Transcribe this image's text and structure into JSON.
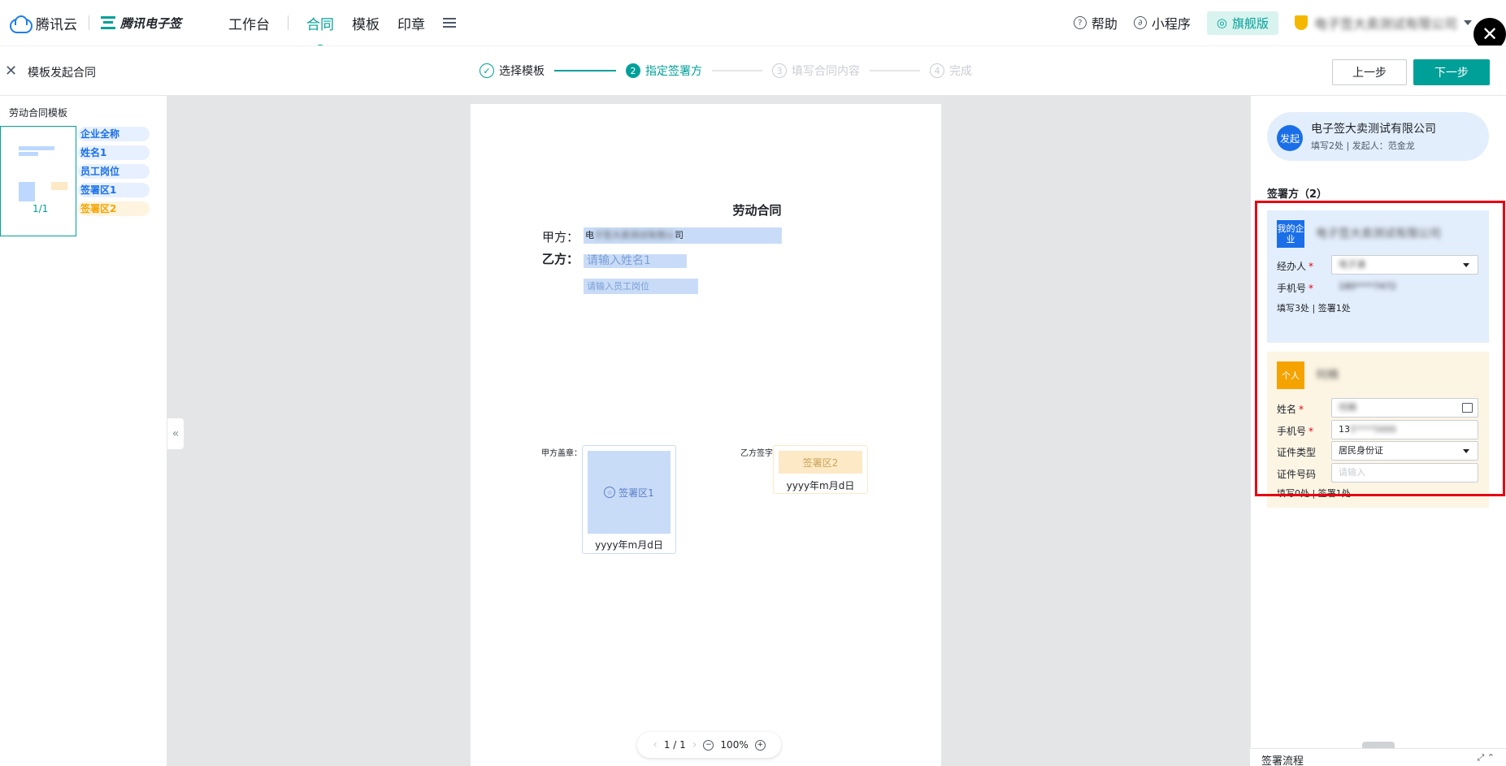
{
  "topbar": {
    "brand": "腾讯云",
    "product": "腾讯电子签",
    "nav": [
      "工作台",
      "合同",
      "模板",
      "印章"
    ],
    "active_nav": "合同",
    "help": "帮助",
    "miniprogram": "小程序",
    "edition": "旗舰版",
    "company": "电子签大卖测试有限公司"
  },
  "subbar": {
    "title": "模板发起合同",
    "steps": [
      {
        "num": "✓",
        "label": "选择模板"
      },
      {
        "num": "2",
        "label": "指定签署方"
      },
      {
        "num": "3",
        "label": "填写合同内容"
      },
      {
        "num": "4",
        "label": "完成"
      }
    ],
    "prev": "上一步",
    "next": "下一步"
  },
  "left": {
    "template_title": "劳动合同模板",
    "page": "1/1",
    "fields": [
      "企业全称",
      "姓名1",
      "员工岗位",
      "签署区1",
      "签署区2"
    ]
  },
  "doc": {
    "title": "劳动合同",
    "party_a": "甲方：",
    "party_b": "乙方：",
    "party_a_value_start": "电",
    "party_a_value_blur": "子签大卖测试有限公",
    "party_a_value_end": "司",
    "name_placeholder": "请输入姓名1",
    "position_placeholder": "请输入员工岗位",
    "seal_a_label": "甲方盖章：",
    "seal_b_label": "乙方签字：",
    "seal_a": "签署区1",
    "seal_b": "签署区2",
    "date": "yyyy年m月d日",
    "pager": "1 / 1",
    "zoom": "100%"
  },
  "right": {
    "initiator_badge": "发起",
    "initiator_name": "电子签大卖测试有限公司",
    "initiator_meta": "填写2处 | 发起人：范金龙",
    "signers_title": "签署方（2）",
    "ent": {
      "badge": "我的企业",
      "name": "电子签大卖测试有限公司",
      "operator_label": "经办人",
      "operator_value": "电子谦",
      "phone_label": "手机号",
      "phone_value": "180****7472",
      "summary": "填写3处 | 签署1处"
    },
    "per": {
      "badge": "个人",
      "name": "何楠",
      "name_label": "姓名",
      "name_value": "何楠",
      "phone_label": "手机号",
      "phone_prefix": "13",
      "phone_rest": "5****5666",
      "id_type_label": "证件类型",
      "id_type_value": "居民身份证",
      "id_no_label": "证件号码",
      "id_no_placeholder": "请输入",
      "summary": "填写0处 | 签署1处"
    },
    "flow": "签署流程"
  }
}
